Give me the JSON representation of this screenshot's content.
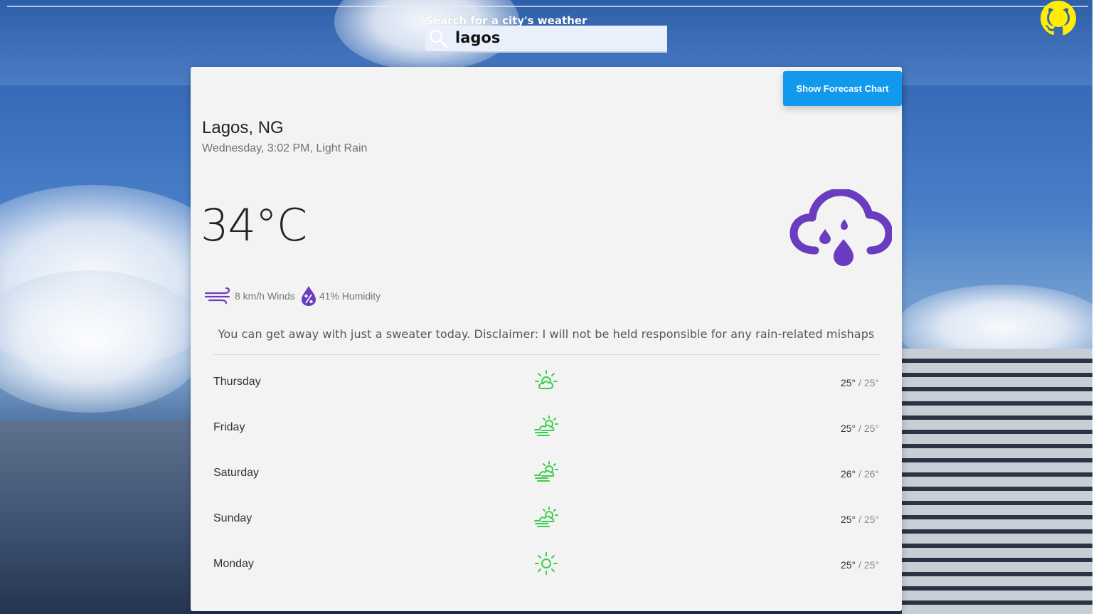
{
  "search": {
    "label": "Search for a city's weather",
    "value": "lagos",
    "placeholder": ""
  },
  "toolbar": {
    "forecast_button_label": "Show Forecast Chart"
  },
  "current": {
    "city": "Lagos, NG",
    "subtitle": "Wednesday, 3:02 PM, Light Rain",
    "temperature": "34°C",
    "condition_icon": "rain-cloud-icon",
    "wind_text": "8 km/h Winds",
    "humidity_text": "41% Humidity",
    "advice": "You can get away with just a sweater today. Disclaimer: I will not be held responsible for any rain-related mishaps"
  },
  "forecast": [
    {
      "day": "Thursday",
      "icon": "sun-cloud-icon",
      "high": "25°",
      "sep": " / ",
      "low": "25°"
    },
    {
      "day": "Friday",
      "icon": "windy-sun-cloud-icon",
      "high": "25°",
      "sep": " / ",
      "low": "25°"
    },
    {
      "day": "Saturday",
      "icon": "windy-sun-cloud-icon",
      "high": "26°",
      "sep": " / ",
      "low": "26°"
    },
    {
      "day": "Sunday",
      "icon": "windy-sun-cloud-icon",
      "high": "25°",
      "sep": " / ",
      "low": "25°"
    },
    {
      "day": "Monday",
      "icon": "sun-icon",
      "high": "25°",
      "sep": " / ",
      "low": "25°"
    }
  ],
  "colors": {
    "accent": "#1199ee",
    "weather_icon": "#6a3cc0",
    "forecast_icon": "#3ccf4e",
    "github_icon": "#ffee00"
  }
}
